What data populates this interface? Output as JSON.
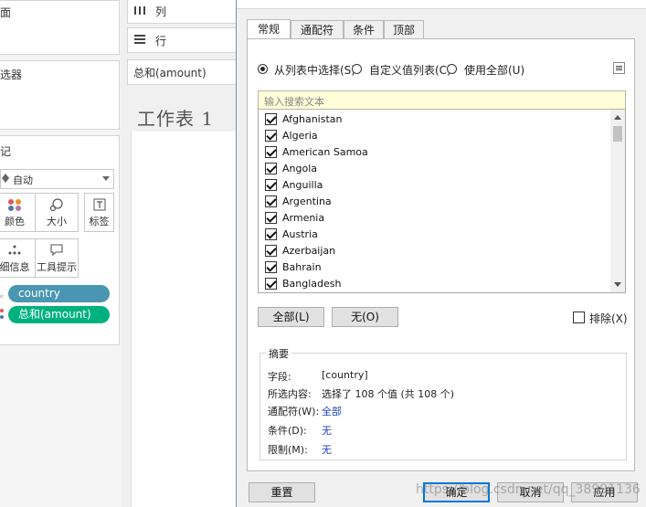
{
  "left_panel": {
    "filters_title": "选器",
    "marks_title": "记",
    "mark_type": "自动",
    "mark_buttons": [
      {
        "label": "颜色",
        "icon": "color-dots-icon"
      },
      {
        "label": "大小",
        "icon": "size-icon"
      },
      {
        "label": "标签",
        "icon": "label-icon"
      },
      {
        "label": "细信息",
        "icon": "detail-icon"
      },
      {
        "label": "工具提示",
        "icon": "tooltip-icon"
      }
    ],
    "pills": [
      {
        "label": "country",
        "color": "#4996b2"
      },
      {
        "label": "总和(amount)",
        "color": "#00b180"
      }
    ],
    "top_label": "面"
  },
  "shelves": {
    "columns": "列",
    "rows": "行",
    "filter_pill": "总和(amount)"
  },
  "worksheet_title": "工作表 1",
  "dialog": {
    "tabs": [
      {
        "label": "常规",
        "active": true
      },
      {
        "label": "通配符",
        "active": false
      },
      {
        "label": "条件",
        "active": false
      },
      {
        "label": "顶部",
        "active": false
      }
    ],
    "radio_options": [
      {
        "label": "从列表中选择(S)",
        "selected": true
      },
      {
        "label": "自定义值列表(C)",
        "selected": false
      },
      {
        "label": "使用全部(U)",
        "selected": false
      }
    ],
    "search_placeholder": "输入搜索文本",
    "list_items": [
      {
        "label": "Afghanistan",
        "checked": true
      },
      {
        "label": "Algeria",
        "checked": true
      },
      {
        "label": "American Samoa",
        "checked": true
      },
      {
        "label": "Angola",
        "checked": true
      },
      {
        "label": "Anguilla",
        "checked": true
      },
      {
        "label": "Argentina",
        "checked": true
      },
      {
        "label": "Armenia",
        "checked": true
      },
      {
        "label": "Austria",
        "checked": true
      },
      {
        "label": "Azerbaijan",
        "checked": true
      },
      {
        "label": "Bahrain",
        "checked": true
      },
      {
        "label": "Bangladesh",
        "checked": true
      }
    ],
    "select_all_label": "全部(L)",
    "select_none_label": "无(O)",
    "exclude_label": "排除(X)",
    "summary": {
      "title": "摘要",
      "rows": [
        {
          "key": "字段:",
          "value": "[country]",
          "link": false
        },
        {
          "key": "所选内容:",
          "value": "选择了 108 个值 (共 108 个)",
          "link": false
        },
        {
          "key": "通配符(W):",
          "value": "全部",
          "link": true
        },
        {
          "key": "条件(D):",
          "value": "无",
          "link": true
        },
        {
          "key": "限制(M):",
          "value": "无",
          "link": true
        }
      ]
    },
    "footer_buttons": {
      "reset": "重置",
      "ok": "确定",
      "cancel": "取消",
      "apply": "应用"
    }
  },
  "watermark": "https://blog.csdn.net/qq_38991136"
}
